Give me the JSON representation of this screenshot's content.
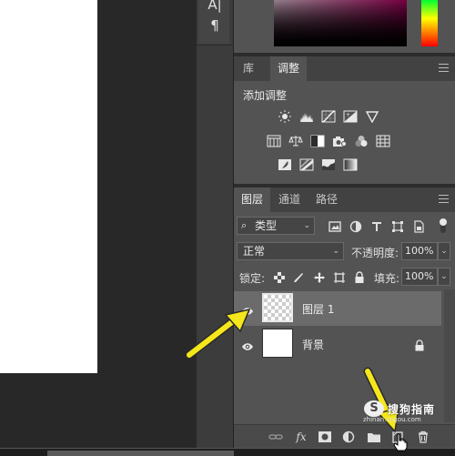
{
  "toolbar": {
    "type_tool_glyph": "A|",
    "paragraph_glyph": "¶"
  },
  "adjustments_panel": {
    "tabs": [
      {
        "label": "库",
        "active": false
      },
      {
        "label": "调整",
        "active": true
      }
    ],
    "title": "添加调整",
    "icons_row1": [
      "brightness-contrast-icon",
      "levels-icon",
      "curves-icon",
      "exposure-icon",
      "vibrance-icon"
    ],
    "icons_row2": [
      "hue-saturation-icon",
      "color-balance-icon",
      "black-white-icon",
      "photo-filter-icon",
      "channel-mixer-icon",
      "color-lookup-icon"
    ],
    "icons_row3": [
      "invert-icon",
      "posterize-icon",
      "threshold-icon",
      "gradient-map-icon"
    ]
  },
  "layers_panel": {
    "tabs": [
      {
        "label": "图层",
        "active": true
      },
      {
        "label": "通道",
        "active": false
      },
      {
        "label": "路径",
        "active": false
      }
    ],
    "filter": {
      "label": "类型",
      "icon": "search-icon"
    },
    "blend_mode": "正常",
    "opacity_label": "不透明度:",
    "opacity_value": "100%",
    "lock_label": "锁定:",
    "fill_label": "填充:",
    "fill_value": "100%",
    "layers": [
      {
        "name": "图层 1",
        "selected": true,
        "visible": true,
        "thumbnail": "transparent"
      },
      {
        "name": "背景",
        "selected": false,
        "visible": true,
        "thumbnail": "white",
        "locked": true
      }
    ],
    "footer_icons": [
      "link-layers-icon",
      "fx-icon",
      "add-mask-icon",
      "adjustment-layer-icon",
      "new-group-icon",
      "new-layer-icon",
      "delete-icon"
    ],
    "footer_fx": "fx"
  },
  "watermark": {
    "main": "搜狗指南",
    "sub": "zhinan.sogou.com",
    "logo": "S"
  },
  "colors": {
    "panel_bg": "#535353",
    "tab_bar": "#424242",
    "selected_row": "#6b6b6b",
    "arrow_yellow": "#f5e71a"
  }
}
